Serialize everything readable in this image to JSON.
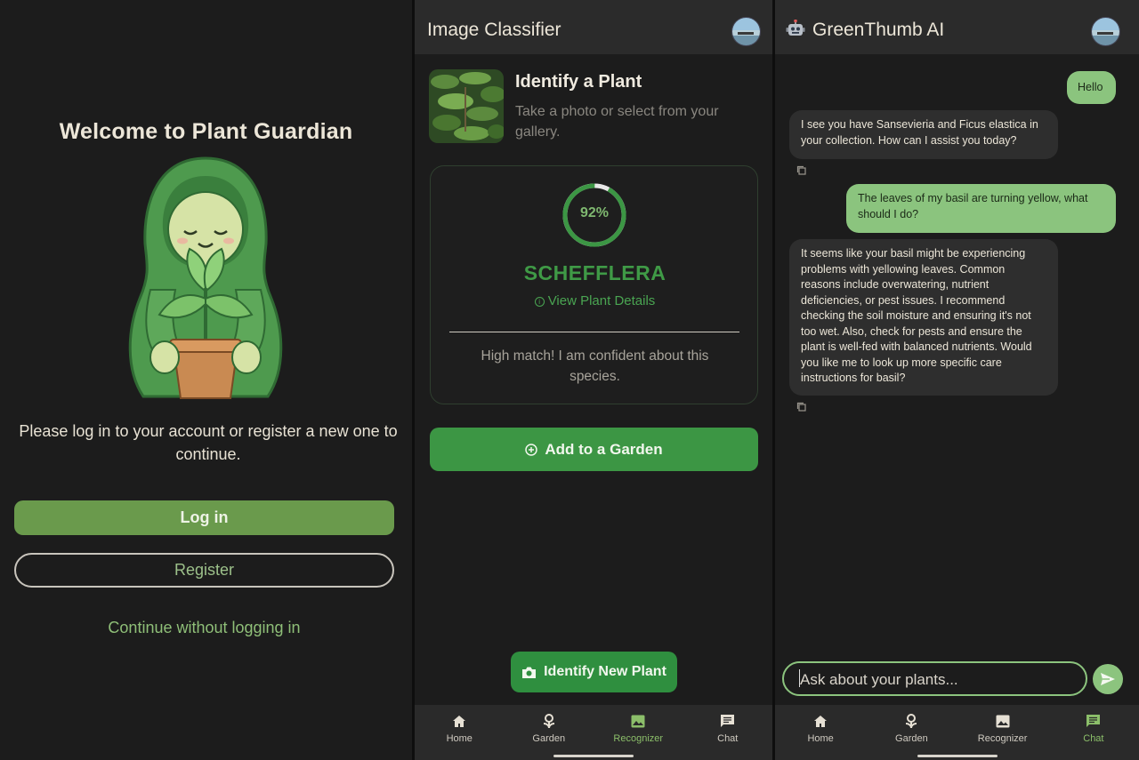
{
  "login": {
    "title": "Welcome to Plant Guardian",
    "message": "Please log in to your account or register a new one to continue.",
    "login_label": "Log in",
    "register_label": "Register",
    "continue_label": "Continue without logging in"
  },
  "classifier": {
    "app_title": "Image Classifier",
    "identify_title": "Identify a Plant",
    "identify_subtitle": "Take a photo or select from your gallery.",
    "confidence_label": "92%",
    "confidence": 0.92,
    "species": "SCHEFFLERA",
    "details_link": "View Plant Details",
    "match_message": "High match! I am confident about this species.",
    "add_button": "Add to a Garden",
    "fab_label": "Identify New Plant"
  },
  "nav": {
    "items": [
      {
        "label": "Home",
        "icon": "home-icon"
      },
      {
        "label": "Garden",
        "icon": "garden-icon"
      },
      {
        "label": "Recognizer",
        "icon": "image-icon"
      },
      {
        "label": "Chat",
        "icon": "chat-icon"
      }
    ]
  },
  "chat": {
    "title": "GreenThumb AI",
    "messages": [
      {
        "role": "user",
        "text": "Hello"
      },
      {
        "role": "bot",
        "text": "I see you have Sansevieria and Ficus elastica in your collection. How can I assist you today?"
      },
      {
        "role": "user",
        "text": "The leaves of my basil are turning yellow, what should I do?"
      },
      {
        "role": "bot",
        "text": "It seems like your basil might be experiencing problems with yellowing leaves. Common reasons include overwatering, nutrient deficiencies, or pest issues. I recommend checking the soil moisture and ensuring it's not too wet. Also, check for pests and ensure the plant is well-fed with balanced nutrients. Would you like me to look up more specific care instructions for basil?"
      }
    ],
    "input_placeholder": "Ask about your plants..."
  },
  "colors": {
    "primary_green": "#3c9644",
    "light_green": "#8bc47e",
    "background": "#1c1c1c",
    "surface": "#2b2b2b"
  }
}
